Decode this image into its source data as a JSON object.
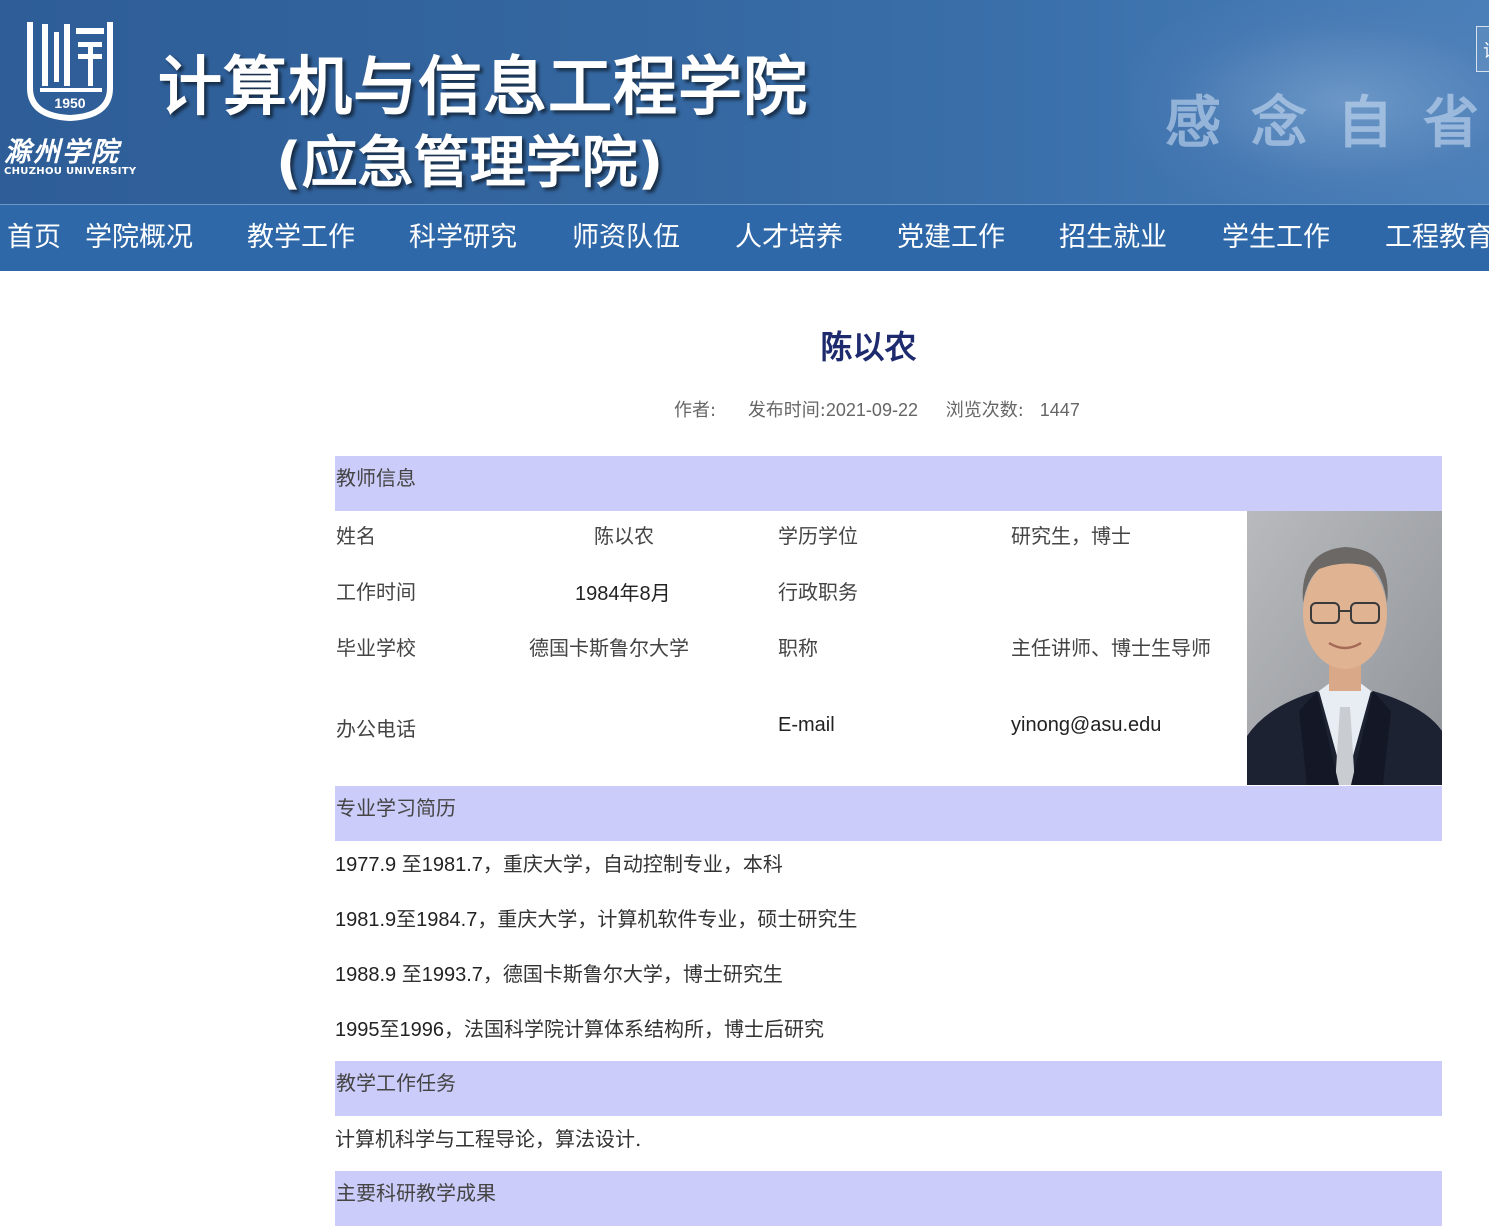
{
  "header": {
    "logo_year": "1950",
    "logo_cn": "滁州学院",
    "logo_en": "CHUZHOU UNIVERSITY",
    "title": "计算机与信息工程学院",
    "subtitle": "(应急管理学院)",
    "motto": "感念自省做",
    "search_text": "试"
  },
  "nav": {
    "items": [
      "首页",
      "学院概况",
      "教学工作",
      "科学研究",
      "师资队伍",
      "人才培养",
      "党建工作",
      "招生就业",
      "学生工作",
      "工程教育"
    ]
  },
  "article": {
    "title": "陈以农",
    "author_label": "作者:",
    "date_label": "发布时间:",
    "date": "2021-09-22",
    "views_label": "浏览次数:",
    "views": "1447"
  },
  "teacher_info": {
    "section_title": "教师信息",
    "name_label": "姓名",
    "name": "陈以农",
    "degree_label": "学历学位",
    "degree": "研究生，博士",
    "work_time_label": "工作时间",
    "work_time": "1984年8月",
    "admin_label": "行政职务",
    "admin": "",
    "school_label": "毕业学校",
    "school": "德国卡斯鲁尔大学",
    "rank_label": "职称",
    "rank": "主任讲师、博士生导师",
    "phone_label": "办公电话",
    "phone": "",
    "email_label": "E-mail",
    "email": "yinong@asu.edu"
  },
  "education": {
    "section_title": "专业学习简历",
    "lines": [
      {
        "num": "1977.9 ",
        "mid": "至",
        "num2": "1981.7",
        "rest": "，重庆大学，自动控制专业，本科"
      },
      {
        "num": "1981.9",
        "mid": "至",
        "num2": "1984.7",
        "rest": "，重庆大学，计算机软件专业，硕士研究生"
      },
      {
        "num": "1988.9 ",
        "mid": "至",
        "num2": "1993.7",
        "rest": "，德国卡斯鲁尔大学，博士研究生"
      },
      {
        "num": "1995",
        "mid": "至",
        "num2": "1996",
        "rest": "，法国科学院计算体系结构所，博士后研究"
      }
    ]
  },
  "teaching": {
    "section_title": "教学工作任务",
    "text": "计算机科学与工程导论，算法设计."
  },
  "research": {
    "section_title": "主要科研教学成果"
  },
  "colors": {
    "banner": "#34669f",
    "nav": "#2f68a8",
    "section_bar": "#ccccfa",
    "title": "#1e2a6e"
  }
}
